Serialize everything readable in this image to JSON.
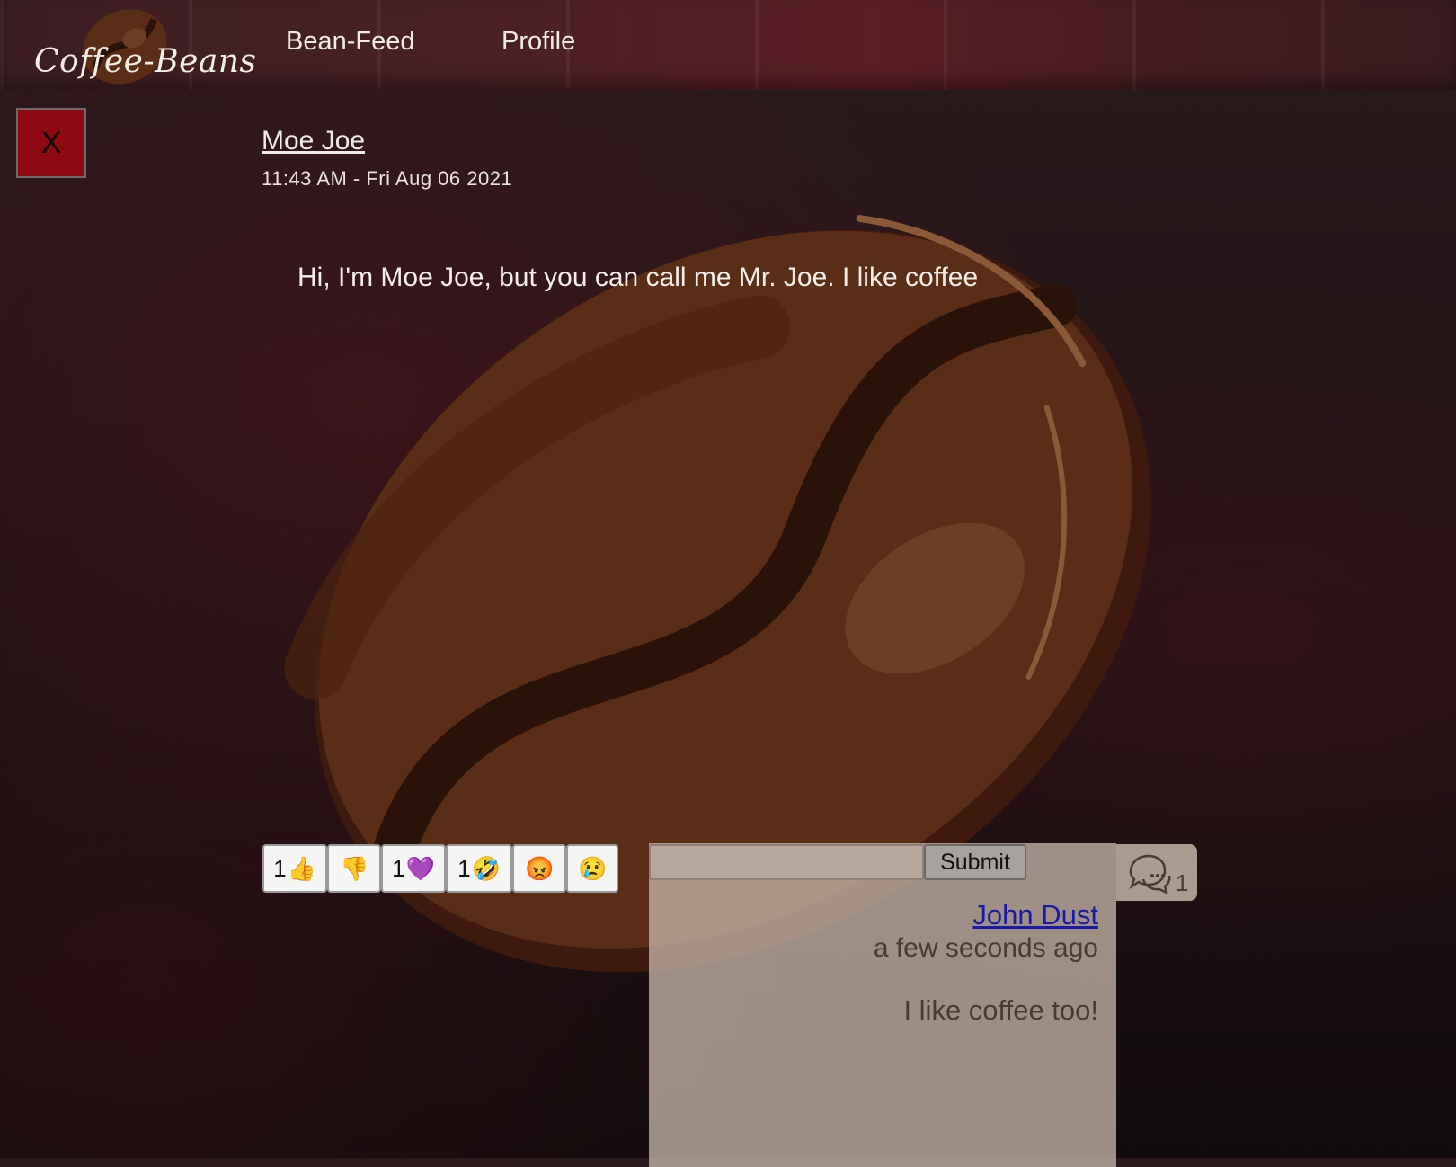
{
  "header": {
    "logo_text": "Coffee-Beans",
    "nav": [
      {
        "label": "Bean-Feed"
      },
      {
        "label": "Profile"
      }
    ]
  },
  "close_button": {
    "label": "X"
  },
  "post": {
    "author": "Moe Joe",
    "timestamp": "11:43 AM - Fri Aug 06 2021",
    "text": "Hi, I'm Moe Joe, but you can call me Mr. Joe. I like coffee"
  },
  "reactions": [
    {
      "count": "1",
      "emoji": "👍",
      "icon": "thumbs-up-icon"
    },
    {
      "count": "",
      "emoji": "👎",
      "icon": "thumbs-down-icon"
    },
    {
      "count": "1",
      "emoji": "💜",
      "icon": "heart-icon"
    },
    {
      "count": "1",
      "emoji": "🤣",
      "icon": "laughing-icon"
    },
    {
      "count": "",
      "emoji": "😡",
      "icon": "angry-icon"
    },
    {
      "count": "",
      "emoji": "😢",
      "icon": "crying-icon"
    }
  ],
  "comments": {
    "input_value": "",
    "submit_label": "Submit",
    "count": "1",
    "items": [
      {
        "author": "John Dust",
        "time": "a few seconds ago",
        "text": "I like coffee too!"
      }
    ]
  },
  "colors": {
    "close_bg": "#8e0a10",
    "link_blue": "#1a1aa8",
    "panel_bg": "#c4b4a6",
    "bean_dark": "#3d1a0d",
    "bean_mid": "#5a2d16",
    "bean_light": "#6e3d22"
  }
}
